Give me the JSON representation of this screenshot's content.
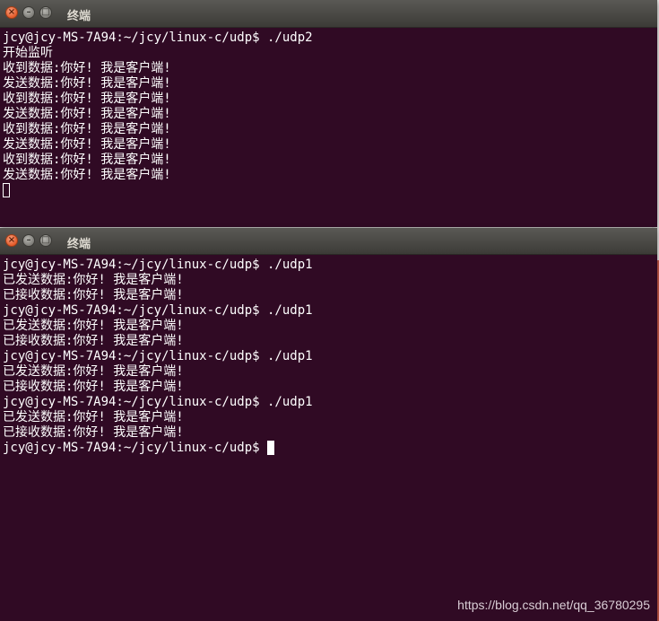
{
  "windows": [
    {
      "title": "终端",
      "lines": [
        "jcy@jcy-MS-7A94:~/jcy/linux-c/udp$ ./udp2",
        "开始监听",
        "收到数据:你好! 我是客户端!",
        "发送数据:你好! 我是客户端!",
        "收到数据:你好! 我是客户端!",
        "发送数据:你好! 我是客户端!",
        "收到数据:你好! 我是客户端!",
        "发送数据:你好! 我是客户端!",
        "收到数据:你好! 我是客户端!",
        "发送数据:你好! 我是客户端!"
      ]
    },
    {
      "title": "终端",
      "lines": [
        "jcy@jcy-MS-7A94:~/jcy/linux-c/udp$ ./udp1",
        "已发送数据:你好! 我是客户端!",
        "已接收数据:你好! 我是客户端!",
        "jcy@jcy-MS-7A94:~/jcy/linux-c/udp$ ./udp1",
        "已发送数据:你好! 我是客户端!",
        "已接收数据:你好! 我是客户端!",
        "jcy@jcy-MS-7A94:~/jcy/linux-c/udp$ ./udp1",
        "已发送数据:你好! 我是客户端!",
        "已接收数据:你好! 我是客户端!",
        "jcy@jcy-MS-7A94:~/jcy/linux-c/udp$ ./udp1",
        "已发送数据:你好! 我是客户端!",
        "已接收数据:你好! 我是客户端!"
      ],
      "prompt": "jcy@jcy-MS-7A94:~/jcy/linux-c/udp$ "
    }
  ],
  "watermark": "https://blog.csdn.net/qq_36780295",
  "colors": {
    "terminal_bg": "#300a24",
    "terminal_fg": "#ffffff",
    "titlebar": "#3c3b37",
    "close_button": "#e45b2a"
  },
  "icons": {
    "close": "close-icon",
    "minimize": "minimize-icon",
    "maximize": "maximize-icon"
  }
}
